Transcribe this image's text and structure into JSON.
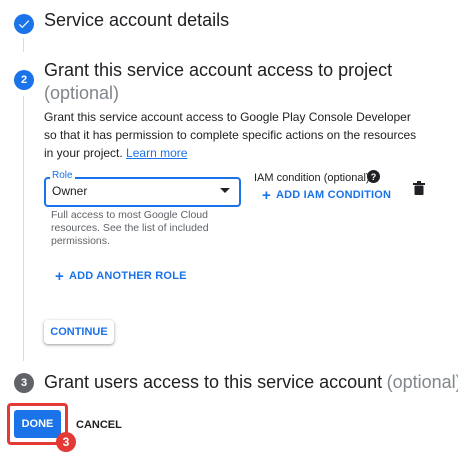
{
  "steps": [
    {
      "title": "Service account details"
    },
    {
      "number": "2",
      "title": "Grant this service account access to project",
      "optional": "(optional)",
      "description": "Grant this service account access to Google Play Console Developer so that it has permission to complete specific actions on the resources in your project.",
      "link": "Learn more"
    },
    {
      "number": "3",
      "title": "Grant users access to this service account",
      "optional": "(optional)"
    }
  ],
  "role": {
    "label": "Role",
    "value": "Owner",
    "hint": "Full access to most Google Cloud resources. See the list of included permissions."
  },
  "iam": {
    "title": "IAM condition (optional)",
    "help": "?",
    "add_label": "ADD IAM CONDITION"
  },
  "actions": {
    "add_role": "ADD ANOTHER ROLE",
    "continue": "CONTINUE",
    "done": "DONE",
    "cancel": "CANCEL"
  },
  "annotation_badge": "3",
  "colors": {
    "accent": "#1a73e8",
    "highlight": "#e53935",
    "muted": "#5f6368"
  }
}
